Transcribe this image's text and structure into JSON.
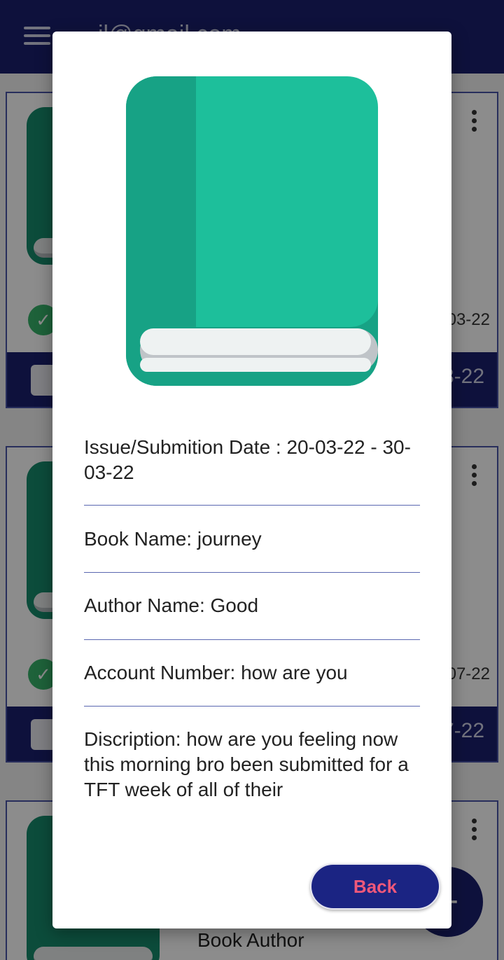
{
  "appbar": {
    "title": "il@gmail.com",
    "menu_icon": "menu-icon"
  },
  "list": {
    "cards": [
      {
        "date_fragment": "03-22",
        "footer_fragment": "3-22"
      },
      {
        "date_fragment": "07-22",
        "footer_fragment": "7-22"
      },
      {
        "author_label": "Book Author"
      }
    ],
    "fab_label": "+"
  },
  "dialog": {
    "image_icon": "book-icon",
    "issue_line": "Issue/Submition Date : 20-03-22 - 30-03-22",
    "book_name_line": "Book Name:  journey",
    "author_name_line": "Author Name:  Good",
    "account_line": "Account Number: how are you",
    "description_line": "Discription: how are you feeling now this morning bro been submitted for a TFT week of all of their",
    "back_label": "Back"
  },
  "colors": {
    "appbar": "#1b1f6e",
    "book_cover": "#1dbf9b",
    "book_spine": "#17a285",
    "back_button": "#1b2483",
    "back_text": "#f0587a",
    "divider": "#5a67b0"
  }
}
